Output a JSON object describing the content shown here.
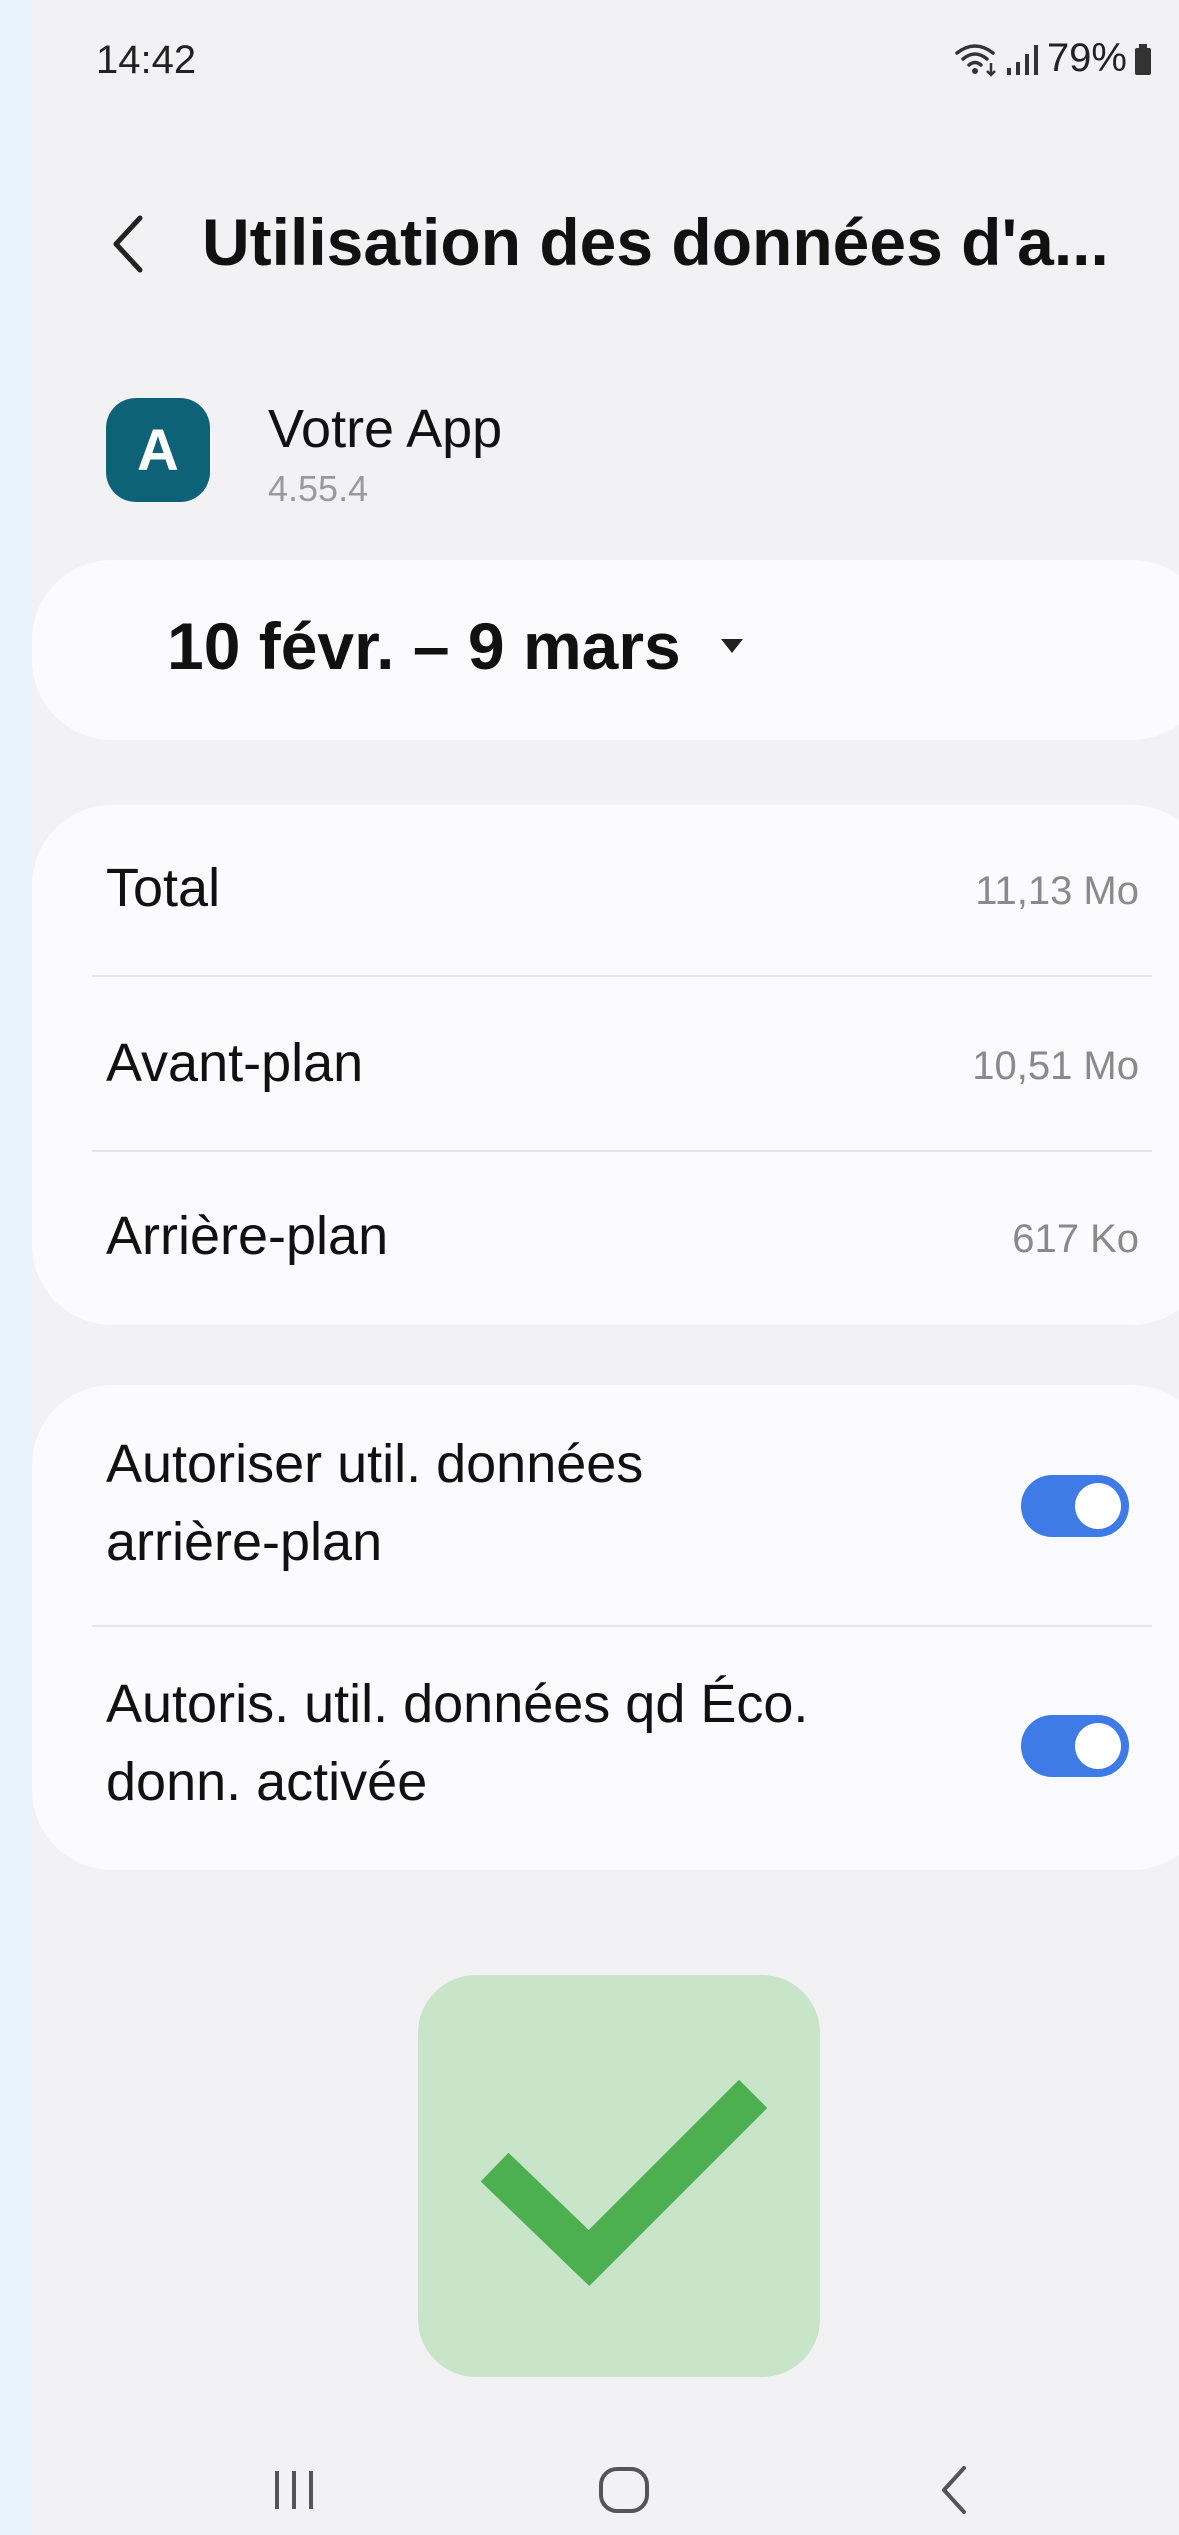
{
  "status_bar": {
    "time": "14:42",
    "battery": "79%"
  },
  "header": {
    "title": "Utilisation des données d'a...",
    "back_icon": "chevron-left-icon"
  },
  "app": {
    "icon_letter": "A",
    "icon_color": "#0e6278",
    "name": "Votre App",
    "version": "4.55.4"
  },
  "period": {
    "label": "10 févr. – 9 mars"
  },
  "usage": [
    {
      "label": "Total",
      "value": "11,13 Mo"
    },
    {
      "label": "Avant-plan",
      "value": "10,51 Mo"
    },
    {
      "label": "Arrière-plan",
      "value": "617 Ko"
    }
  ],
  "toggles": [
    {
      "line1": "Autoriser util. données",
      "line2": "arrière-plan",
      "enabled": true
    },
    {
      "line1": "Autoris. util. données qd Éco.",
      "line2": "donn. activée",
      "enabled": true
    }
  ],
  "colors": {
    "accent": "#3e7be6",
    "check_bg": "#c8e5c9",
    "check": "#4caf50"
  },
  "overlay_icon": "checkmark-icon",
  "nav_icons": [
    "recent-apps-icon",
    "home-icon",
    "back-icon"
  ]
}
